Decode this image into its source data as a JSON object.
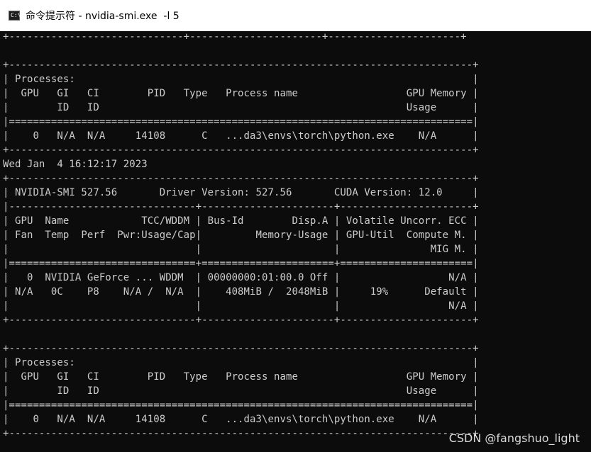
{
  "window": {
    "title": "命令提示符 - nvidia-smi.exe  -l 5",
    "icon": "terminal-icon",
    "icon_glyph": "C:\\"
  },
  "console": {
    "lines": [
      "+-----------------------------+----------------------+----------------------+",
      "",
      "+-----------------------------------------------------------------------------+",
      "| Processes:                                                                  |",
      "|  GPU   GI   CI        PID   Type   Process name                  GPU Memory |",
      "|        ID   ID                                                   Usage      |",
      "|=============================================================================|",
      "|    0   N/A  N/A     14108      C   ...da3\\envs\\torch\\python.exe    N/A      |",
      "+-----------------------------------------------------------------------------+",
      "Wed Jan  4 16:12:17 2023",
      "+-----------------------------------------------------------------------------+",
      "| NVIDIA-SMI 527.56       Driver Version: 527.56       CUDA Version: 12.0     |",
      "|-------------------------------+----------------------+----------------------+",
      "| GPU  Name            TCC/WDDM | Bus-Id        Disp.A | Volatile Uncorr. ECC |",
      "| Fan  Temp  Perf  Pwr:Usage/Cap|         Memory-Usage | GPU-Util  Compute M. |",
      "|                               |                      |               MIG M. |",
      "|===============================+======================+======================|",
      "|   0  NVIDIA GeForce ... WDDM  | 00000000:01:00.0 Off |                  N/A |",
      "| N/A   0C    P8    N/A /  N/A  |    408MiB /  2048MiB |     19%      Default |",
      "|                               |                      |                  N/A |",
      "+-------------------------------+----------------------+----------------------+",
      "",
      "+-----------------------------------------------------------------------------+",
      "| Processes:                                                                  |",
      "|  GPU   GI   CI        PID   Type   Process name                  GPU Memory |",
      "|        ID   ID                                                   Usage      |",
      "|=============================================================================|",
      "|    0   N/A  N/A     14108      C   ...da3\\envs\\torch\\python.exe    N/A      |",
      "+-----------------------------------------------------------------------------+"
    ]
  },
  "watermark": "CSDN @fangshuo_light",
  "colors": {
    "console_background": "#0c0c0c",
    "console_text": "#cccccc",
    "titlebar_background": "#ffffff"
  }
}
